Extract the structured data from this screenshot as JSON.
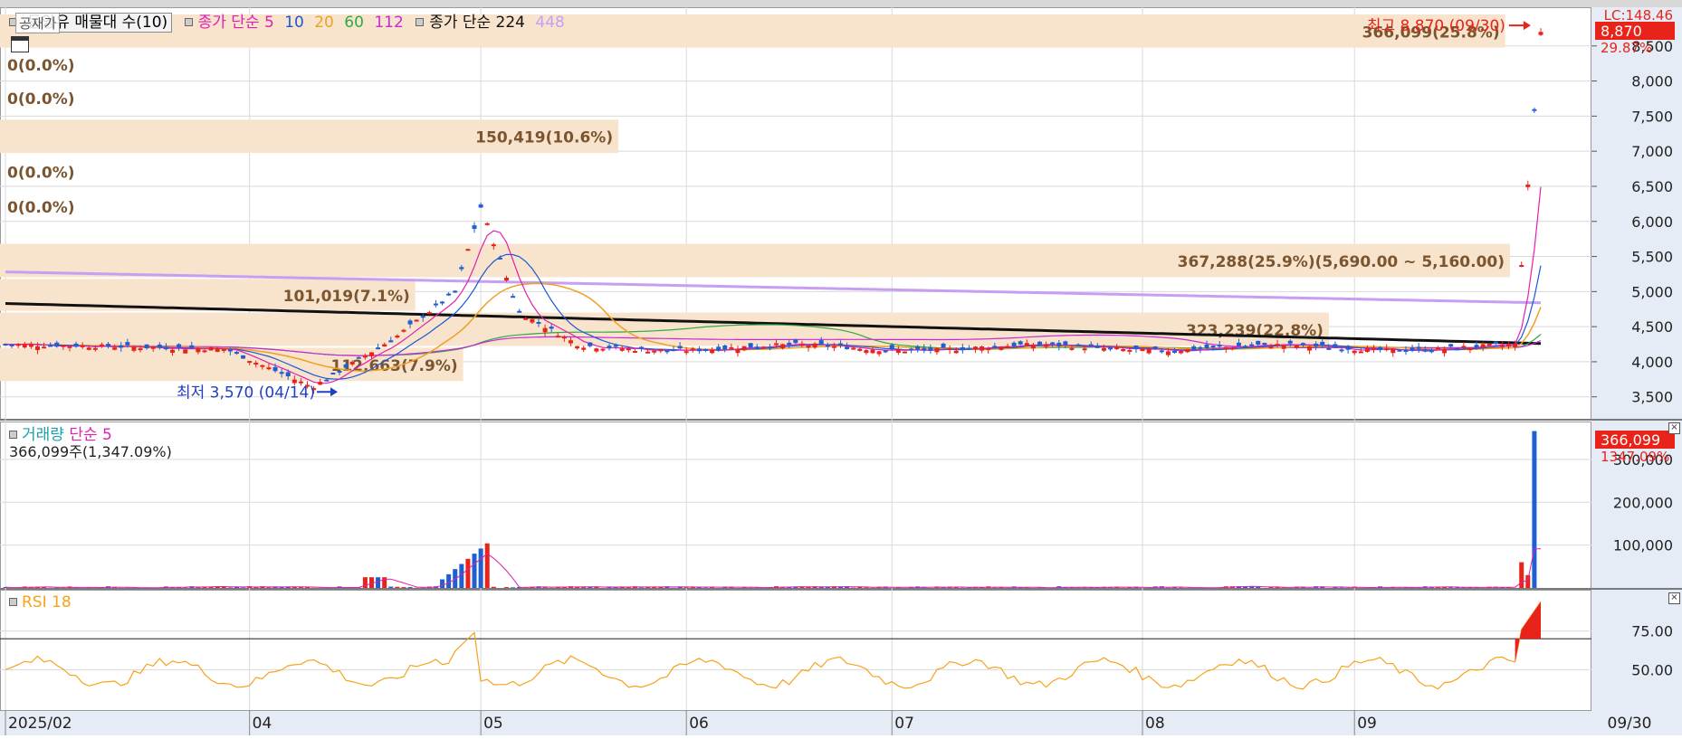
{
  "legend": {
    "stock_name": "동양유 매물대 수(10)",
    "sma_prefix": "종가 단순 5",
    "sma_periods": [
      "10",
      "20",
      "60",
      "112"
    ],
    "sma2_prefix": "종가 단순 224",
    "sma2_extra": "448",
    "public_tag": "공재가"
  },
  "colors": {
    "up": "#e8231a",
    "down": "#1f5fcf",
    "ma5": "#e020b0",
    "ma10": "#1a58d6",
    "ma20": "#f0a020",
    "ma60": "#2fa848",
    "ma112": "#c828d8",
    "ma224": "#111111",
    "ma448": "#c89ef2",
    "band": "#f8e4cc",
    "grid": "#d9d9d9",
    "axis_bg": "#e6ecf5",
    "rsi": "#f7a21b"
  },
  "price_axis": {
    "ticks": [
      "3,500",
      "4,000",
      "4,500",
      "5,000",
      "5,500",
      "6,000",
      "6,500",
      "7,000",
      "7,500",
      "8,000",
      "8,500"
    ],
    "tick_values": [
      3500,
      4000,
      4500,
      5000,
      5500,
      6000,
      6500,
      7000,
      7500,
      8000,
      8500
    ],
    "range": [
      3200,
      9000
    ],
    "top_label": "LC:148.46",
    "current_price": "8,870",
    "current_change": "29.87%"
  },
  "volume_profile": [
    {
      "label": "366,099(25.8%)",
      "price_low": 8450,
      "price_high": 8950,
      "value": 366099
    },
    {
      "label": "0(0.0%)",
      "price_low": 8000,
      "price_high": 8450,
      "value": 0
    },
    {
      "label": "0(0.0%)",
      "price_low": 7500,
      "price_high": 8000,
      "value": 0
    },
    {
      "label": "150,419(10.6%)",
      "price_low": 6950,
      "price_high": 7450,
      "value": 150419
    },
    {
      "label": "0(0.0%)",
      "price_low": 6450,
      "price_high": 6950,
      "value": 0
    },
    {
      "label": "0(0.0%)",
      "price_low": 5950,
      "price_high": 6450,
      "value": 0
    },
    {
      "label": "367,288(25.9%)(5,690.00 ~ 5,160.00)",
      "price_low": 5180,
      "price_high": 5680,
      "value": 367288
    },
    {
      "label": "101,019(7.1%)",
      "price_low": 4700,
      "price_high": 5180,
      "value": 101019
    },
    {
      "label": "323,239(22.8%)",
      "price_low": 4200,
      "price_high": 4700,
      "value": 323239
    },
    {
      "label": "112,663(7.9%)",
      "price_low": 3700,
      "price_high": 4200,
      "value": 112663
    }
  ],
  "annotations": {
    "high": "최고 8,870 (09/30)",
    "low": "최저 3,570 (04/14)"
  },
  "x_axis": {
    "labels": [
      "2025/02",
      "04",
      "05",
      "06",
      "07",
      "08",
      "09"
    ],
    "label_index": [
      0,
      38,
      74,
      106,
      138,
      177,
      210
    ],
    "last_date": "09/30"
  },
  "volume": {
    "legend_a": "거래량",
    "legend_b": "단순 5",
    "value_text": "366,099주(1,347.09%)",
    "ticks": [
      "100,000",
      "200,000",
      "300,000"
    ],
    "tick_values": [
      100000,
      200000,
      300000
    ],
    "range": [
      0,
      380000
    ],
    "last_value": "366,099",
    "last_change": "1347.09%"
  },
  "rsi": {
    "legend": "RSI 18",
    "ticks": [
      "50.00",
      "75.00"
    ],
    "tick_values": [
      50,
      75
    ],
    "range": [
      25,
      100
    ],
    "overbought": 70
  },
  "chart_data": {
    "type": "candlestick",
    "title": "동양유 매물대 수(10)",
    "xlabel": "",
    "ylabel": "",
    "ylim": [
      3200,
      9000
    ],
    "x": [
      "2025/02",
      "04",
      "05",
      "06",
      "07",
      "08",
      "09",
      "09/30"
    ],
    "series": [
      {
        "name": "price",
        "close_high": 8870,
        "close_low": 3570,
        "last_close": 8870
      },
      {
        "name": "종가 단순 224",
        "start": 4830,
        "end": 4260
      },
      {
        "name": "448",
        "start": 5280,
        "end": 4840
      }
    ]
  }
}
